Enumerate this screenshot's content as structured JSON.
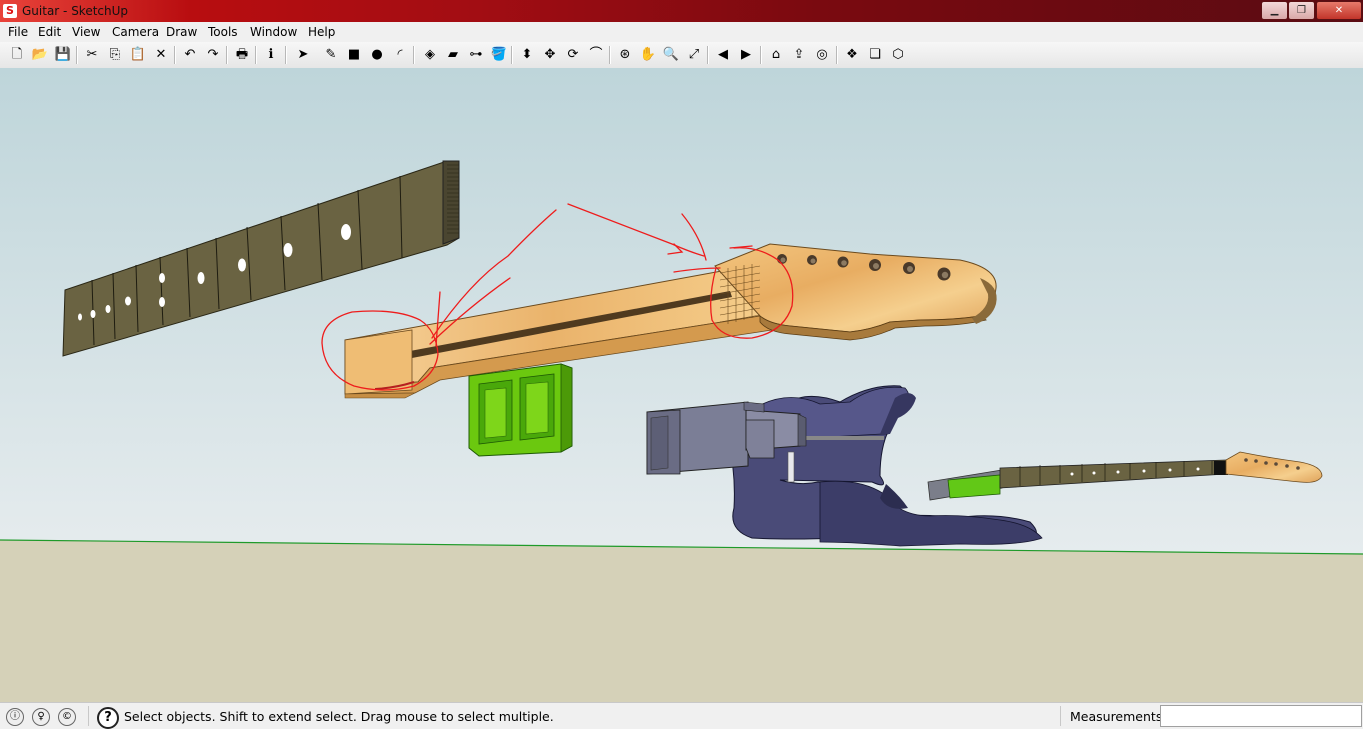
{
  "window": {
    "title": "Guitar - SketchUp",
    "app_icon": "sketchup-logo-icon",
    "controls": {
      "minimize": "minimize-icon",
      "maximize": "maximize-icon",
      "close": "close-icon"
    }
  },
  "menu": [
    "File",
    "Edit",
    "View",
    "Camera",
    "Draw",
    "Tools",
    "Window",
    "Help"
  ],
  "toolbar": [
    {
      "name": "new-icon",
      "glyph": "🗋"
    },
    {
      "name": "open-icon",
      "glyph": "📂"
    },
    {
      "name": "save-icon",
      "glyph": "💾"
    },
    {
      "name": "cut-icon",
      "glyph": "✂"
    },
    {
      "name": "copy-icon",
      "glyph": "⎘"
    },
    {
      "name": "paste-icon",
      "glyph": "📋"
    },
    {
      "name": "erase-icon",
      "glyph": "✕"
    },
    {
      "name": "undo-icon",
      "glyph": "↶"
    },
    {
      "name": "redo-icon",
      "glyph": "↷"
    },
    {
      "name": "print-icon",
      "glyph": "🖶"
    },
    {
      "name": "model-info-icon",
      "glyph": "ℹ"
    },
    {
      "name": "select-arrow-icon",
      "glyph": "➤"
    },
    {
      "name": "line-pencil-icon",
      "glyph": "✎"
    },
    {
      "name": "rectangle-icon",
      "glyph": "■"
    },
    {
      "name": "circle-icon",
      "glyph": "●"
    },
    {
      "name": "arc-icon",
      "glyph": "◜"
    },
    {
      "name": "make-component-icon",
      "glyph": "◈"
    },
    {
      "name": "eraser-icon",
      "glyph": "▰"
    },
    {
      "name": "tape-measure-icon",
      "glyph": "⊶"
    },
    {
      "name": "paint-bucket-icon",
      "glyph": "🪣"
    },
    {
      "name": "push-pull-icon",
      "glyph": "⬍"
    },
    {
      "name": "move-icon",
      "glyph": "✥"
    },
    {
      "name": "rotate-icon",
      "glyph": "⟳"
    },
    {
      "name": "offset-icon",
      "glyph": "⌒"
    },
    {
      "name": "orbit-icon",
      "glyph": "⊛"
    },
    {
      "name": "pan-hand-icon",
      "glyph": "✋"
    },
    {
      "name": "zoom-icon",
      "glyph": "🔍"
    },
    {
      "name": "zoom-extents-icon",
      "glyph": "⤢"
    },
    {
      "name": "previous-view-icon",
      "glyph": "◀"
    },
    {
      "name": "next-view-icon",
      "glyph": "▶"
    },
    {
      "name": "get-models-icon",
      "glyph": "⌂"
    },
    {
      "name": "share-model-icon",
      "glyph": "⇪"
    },
    {
      "name": "warehouse-icon",
      "glyph": "◎"
    },
    {
      "name": "get-components-icon",
      "glyph": "❖"
    },
    {
      "name": "share-component-icon",
      "glyph": "❏"
    },
    {
      "name": "extension-icon",
      "glyph": "⬡"
    }
  ],
  "status": {
    "message": "Select objects. Shift to extend select. Drag mouse to select multiple.",
    "measurements_label": "Measurements",
    "measurements_value": "",
    "icons": [
      "geo-location-icon",
      "credits-icon",
      "copyright-icon",
      "help-icon"
    ]
  },
  "scene": {
    "sky_top": "#bcd4da",
    "sky_bottom": "#e3eaec",
    "ground": "#d5d1b8",
    "horizon_line": "#1f9a2a",
    "annotation_color": "#ee1c1c",
    "objects": [
      "fretboard",
      "guitar-neck-maple",
      "neck-pocket-block",
      "assembled-guitar"
    ]
  }
}
